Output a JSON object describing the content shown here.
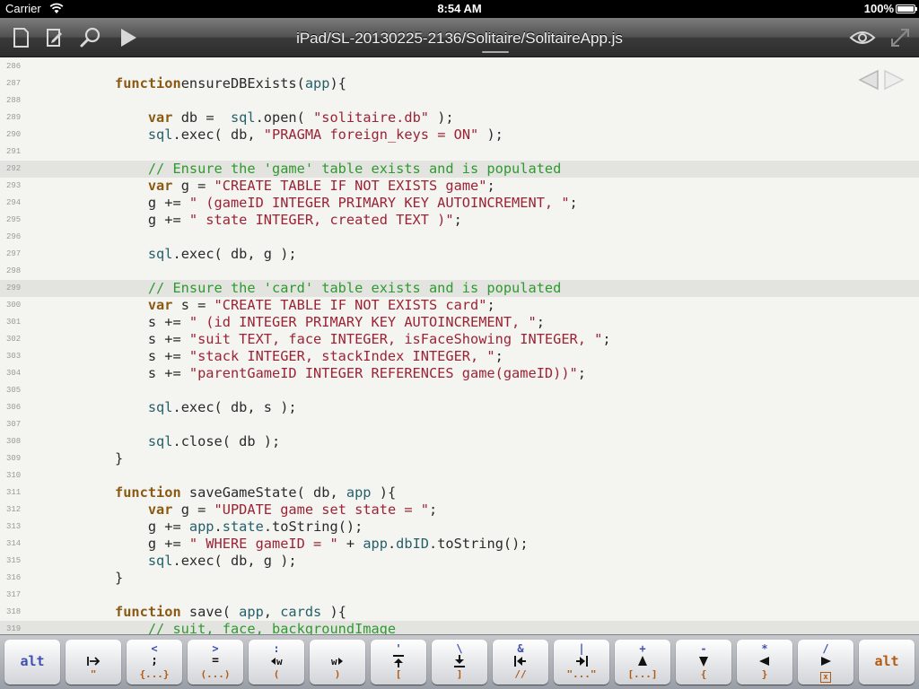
{
  "status_bar": {
    "carrier": "Carrier",
    "time": "8:54 AM",
    "battery": "100%"
  },
  "toolbar": {
    "title": "iPad/SL-20130225-2136/Solitaire/SolitaireApp.js"
  },
  "editor": {
    "lines": [
      {
        "n": "286",
        "segs": []
      },
      {
        "n": "287",
        "segs": [
          [
            "k",
            "function"
          ],
          [
            "",
            "ensureDBExists("
          ],
          [
            "i",
            "app"
          ],
          [
            "",
            ")"
          ],
          [
            "",
            "{"
          ]
        ]
      },
      {
        "n": "288",
        "segs": []
      },
      {
        "n": "289",
        "segs": [
          [
            "",
            "    "
          ],
          [
            "k",
            "var"
          ],
          [
            "",
            " db = "
          ],
          [
            "i",
            " sql"
          ],
          [
            "",
            ".open( "
          ],
          [
            "s",
            "\"solitaire.db\""
          ],
          [
            "",
            " );"
          ]
        ]
      },
      {
        "n": "290",
        "segs": [
          [
            "",
            "    "
          ],
          [
            "i",
            "sql"
          ],
          [
            "",
            ".exec( db, "
          ],
          [
            "s",
            "\"PRAGMA foreign_keys = ON\""
          ],
          [
            "",
            " );"
          ]
        ]
      },
      {
        "n": "291",
        "segs": []
      },
      {
        "n": "292",
        "hl": true,
        "segs": [
          [
            "",
            "    "
          ],
          [
            "c",
            "// Ensure the 'game' table exists and is populated"
          ]
        ]
      },
      {
        "n": "293",
        "segs": [
          [
            "",
            "    "
          ],
          [
            "k",
            "var"
          ],
          [
            "",
            " g = "
          ],
          [
            "s",
            "\"CREATE TABLE IF NOT EXISTS game\""
          ],
          [
            "",
            ";"
          ]
        ]
      },
      {
        "n": "294",
        "segs": [
          [
            "",
            "    g += "
          ],
          [
            "s",
            "\" (gameID INTEGER PRIMARY KEY AUTOINCREMENT, \""
          ],
          [
            "",
            ";"
          ]
        ]
      },
      {
        "n": "295",
        "segs": [
          [
            "",
            "    g += "
          ],
          [
            "s",
            "\" state INTEGER, created TEXT )\""
          ],
          [
            "",
            ";"
          ]
        ]
      },
      {
        "n": "296",
        "segs": []
      },
      {
        "n": "297",
        "segs": [
          [
            "",
            "    "
          ],
          [
            "i",
            "sql"
          ],
          [
            "",
            ".exec( db, g );"
          ]
        ]
      },
      {
        "n": "298",
        "segs": []
      },
      {
        "n": "299",
        "hl": true,
        "segs": [
          [
            "",
            "    "
          ],
          [
            "c",
            "// Ensure the 'card' table exists and is populated"
          ]
        ]
      },
      {
        "n": "300",
        "segs": [
          [
            "",
            "    "
          ],
          [
            "k",
            "var"
          ],
          [
            "",
            " s = "
          ],
          [
            "s",
            "\"CREATE TABLE IF NOT EXISTS card\""
          ],
          [
            "",
            ";"
          ]
        ]
      },
      {
        "n": "301",
        "segs": [
          [
            "",
            "    s += "
          ],
          [
            "s",
            "\" (id INTEGER PRIMARY KEY AUTOINCREMENT, \""
          ],
          [
            "",
            ";"
          ]
        ]
      },
      {
        "n": "302",
        "segs": [
          [
            "",
            "    s += "
          ],
          [
            "s",
            "\"suit TEXT, face INTEGER, isFaceShowing INTEGER, \""
          ],
          [
            "",
            ";"
          ]
        ]
      },
      {
        "n": "303",
        "segs": [
          [
            "",
            "    s += "
          ],
          [
            "s",
            "\"stack INTEGER, stackIndex INTEGER, \""
          ],
          [
            "",
            ";"
          ]
        ]
      },
      {
        "n": "304",
        "segs": [
          [
            "",
            "    s += "
          ],
          [
            "s",
            "\"parentGameID INTEGER REFERENCES game(gameID))\""
          ],
          [
            "",
            ";"
          ]
        ]
      },
      {
        "n": "305",
        "segs": []
      },
      {
        "n": "306",
        "segs": [
          [
            "",
            "    "
          ],
          [
            "i",
            "sql"
          ],
          [
            "",
            ".exec( db, s );"
          ]
        ]
      },
      {
        "n": "307",
        "segs": []
      },
      {
        "n": "308",
        "segs": [
          [
            "",
            "    "
          ],
          [
            "i",
            "sql"
          ],
          [
            "",
            ".close( db );"
          ]
        ]
      },
      {
        "n": "309",
        "segs": [
          [
            "",
            "}"
          ]
        ]
      },
      {
        "n": "310",
        "segs": []
      },
      {
        "n": "311",
        "segs": [
          [
            "k",
            "function"
          ],
          [
            "",
            " saveGameState( db, "
          ],
          [
            "i",
            "app"
          ],
          [
            "",
            " ){"
          ]
        ]
      },
      {
        "n": "312",
        "segs": [
          [
            "",
            "    "
          ],
          [
            "k",
            "var"
          ],
          [
            "",
            " g = "
          ],
          [
            "s",
            "\"UPDATE game set state = \""
          ],
          [
            "",
            ";"
          ]
        ]
      },
      {
        "n": "313",
        "segs": [
          [
            "",
            "    g += "
          ],
          [
            "i",
            "app"
          ],
          [
            "",
            "."
          ],
          [
            "i",
            "state"
          ],
          [
            "",
            ".toString();"
          ]
        ]
      },
      {
        "n": "314",
        "segs": [
          [
            "",
            "    g += "
          ],
          [
            "s",
            "\" WHERE gameID = \""
          ],
          [
            "",
            " + "
          ],
          [
            "i",
            "app"
          ],
          [
            "",
            "."
          ],
          [
            "i",
            "dbID"
          ],
          [
            "",
            ".toString();"
          ]
        ]
      },
      {
        "n": "315",
        "segs": [
          [
            "",
            "    "
          ],
          [
            "i",
            "sql"
          ],
          [
            "",
            ".exec( db, g );"
          ]
        ]
      },
      {
        "n": "316",
        "segs": [
          [
            "",
            "}"
          ]
        ]
      },
      {
        "n": "317",
        "segs": []
      },
      {
        "n": "318",
        "segs": [
          [
            "k",
            "function"
          ],
          [
            "",
            " save( "
          ],
          [
            "i",
            "app"
          ],
          [
            "",
            ", "
          ],
          [
            "i",
            "cards"
          ],
          [
            "",
            " ){"
          ]
        ]
      },
      {
        "n": "319",
        "hl": true,
        "segs": [
          [
            "",
            "    "
          ],
          [
            "c",
            "// suit, face, backgroundImage"
          ]
        ]
      }
    ]
  },
  "keybar": {
    "keys": [
      {
        "type": "alt",
        "label": "alt",
        "color": "#4050b0"
      },
      {
        "top": "",
        "bottom": "\"",
        "icon": "tab-in"
      },
      {
        "top": "<",
        "mid": ";",
        "bottom": "{...}"
      },
      {
        "top": ">",
        "mid": "=",
        "bottom": "(...)"
      },
      {
        "top": ":",
        "bottom": "(",
        "icon": "word-left"
      },
      {
        "top": "",
        "bottom": ")",
        "icon": "word-right"
      },
      {
        "top": "'",
        "bottom": "[",
        "icon": "doc-up"
      },
      {
        "top": "\\",
        "bottom": "]",
        "icon": "doc-down"
      },
      {
        "top": "&",
        "bottom": "//",
        "icon": "line-start"
      },
      {
        "top": "|",
        "bottom": "\"...\"",
        "icon": "line-end"
      },
      {
        "top": "+",
        "bottom": "[...]",
        "icon": "up"
      },
      {
        "top": "-",
        "bottom": "{",
        "icon": "down"
      },
      {
        "top": "*",
        "bottom": "}",
        "icon": "left"
      },
      {
        "top": "/",
        "bottom": "x",
        "icon": "right"
      },
      {
        "type": "alt",
        "label": "alt",
        "color": "#b25a10"
      }
    ]
  }
}
